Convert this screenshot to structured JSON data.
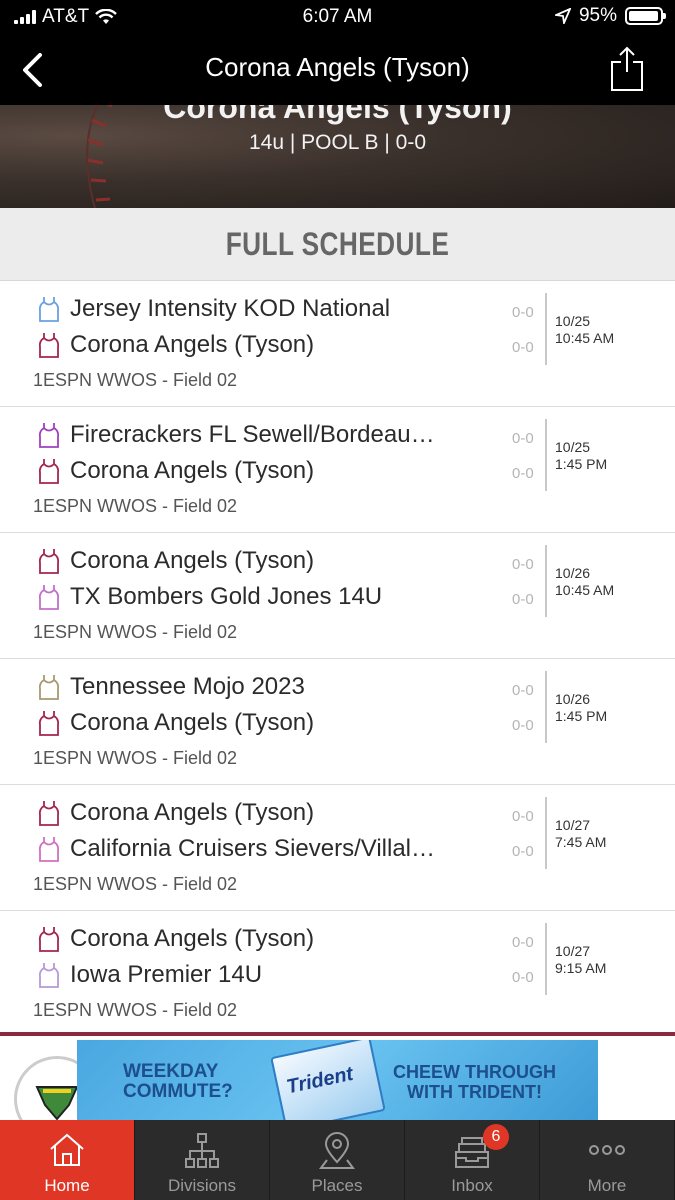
{
  "status_bar": {
    "carrier": "AT&T",
    "time": "6:07 AM",
    "battery": "95%"
  },
  "nav": {
    "title": "Corona Angels (Tyson)"
  },
  "hero": {
    "team_title": "Corona Angels (Tyson)",
    "subtitle": "14u | POOL B | 0-0"
  },
  "section": {
    "title": "FULL SCHEDULE"
  },
  "games": [
    {
      "team1": "Jersey Intensity KOD National",
      "team1_color": "#6aa0e0",
      "team2": "Corona Angels (Tyson)",
      "team2_color": "#a3264f",
      "score1": "0-0",
      "score2": "0-0",
      "date": "10/25",
      "time": "10:45 AM",
      "venue": "1ESPN WWOS - Field 02"
    },
    {
      "team1": "Firecrackers FL Sewell/Bordeau…",
      "team1_color": "#a040c0",
      "team2": "Corona Angels (Tyson)",
      "team2_color": "#a3264f",
      "score1": "0-0",
      "score2": "0-0",
      "date": "10/25",
      "time": "1:45 PM",
      "venue": "1ESPN WWOS - Field 02"
    },
    {
      "team1": "Corona Angels (Tyson)",
      "team1_color": "#a3264f",
      "team2": "TX Bombers Gold Jones 14U",
      "team2_color": "#c070c8",
      "score1": "0-0",
      "score2": "0-0",
      "date": "10/26",
      "time": "10:45 AM",
      "venue": "1ESPN WWOS - Field 02"
    },
    {
      "team1": "Tennessee Mojo 2023",
      "team1_color": "#a89a70",
      "team2": "Corona Angels (Tyson)",
      "team2_color": "#a3264f",
      "score1": "0-0",
      "score2": "0-0",
      "date": "10/26",
      "time": "1:45 PM",
      "venue": "1ESPN WWOS - Field 02"
    },
    {
      "team1": "Corona Angels (Tyson)",
      "team1_color": "#a3264f",
      "team2": "California Cruisers Sievers/Villal…",
      "team2_color": "#d070c0",
      "score1": "0-0",
      "score2": "0-0",
      "date": "10/27",
      "time": "7:45 AM",
      "venue": "1ESPN WWOS - Field 02"
    },
    {
      "team1": "Corona Angels (Tyson)",
      "team1_color": "#a3264f",
      "team2": "Iowa Premier 14U",
      "team2_color": "#b59ad8",
      "score1": "0-0",
      "score2": "0-0",
      "date": "10/27",
      "time": "9:15 AM",
      "venue": "1ESPN WWOS - Field 02"
    }
  ],
  "ad": {
    "line1a": "WEEKDAY",
    "line1b": "COMMUTE?",
    "brand": "Trident",
    "line2a": "CHEEW THROUGH",
    "line2b": "WITH TRIDENT!"
  },
  "tabs": [
    {
      "label": "Home",
      "icon": "home-icon",
      "active": true
    },
    {
      "label": "Divisions",
      "icon": "bracket-icon"
    },
    {
      "label": "Places",
      "icon": "location-pin-icon"
    },
    {
      "label": "Inbox",
      "icon": "inbox-icon",
      "badge": "6"
    },
    {
      "label": "More",
      "icon": "more-dots-icon"
    }
  ],
  "colors": {
    "accent": "#e03626",
    "team_maroon": "#a3264f",
    "ad_border": "#8a2a3f"
  }
}
